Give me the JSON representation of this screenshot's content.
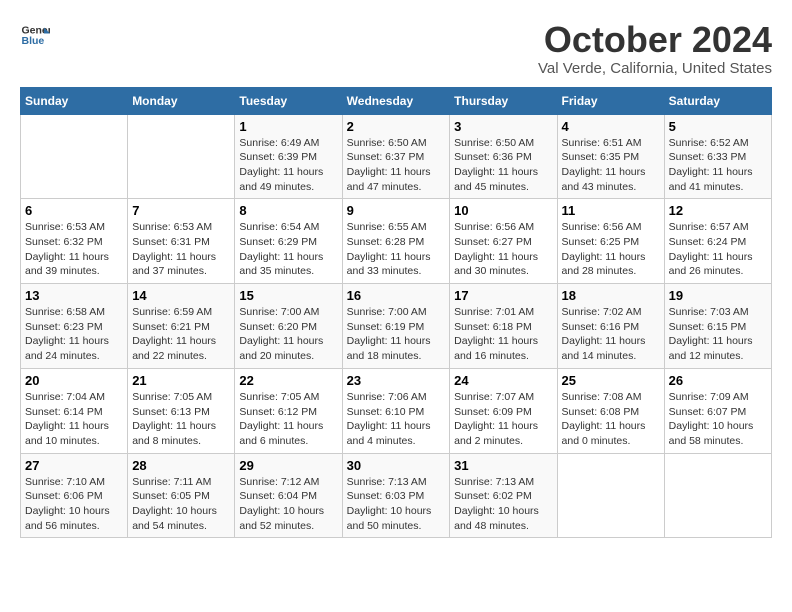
{
  "logo": {
    "line1": "General",
    "line2": "Blue"
  },
  "title": "October 2024",
  "location": "Val Verde, California, United States",
  "days_of_week": [
    "Sunday",
    "Monday",
    "Tuesday",
    "Wednesday",
    "Thursday",
    "Friday",
    "Saturday"
  ],
  "weeks": [
    [
      {
        "day": "",
        "info": ""
      },
      {
        "day": "",
        "info": ""
      },
      {
        "day": "1",
        "info": "Sunrise: 6:49 AM\nSunset: 6:39 PM\nDaylight: 11 hours and 49 minutes."
      },
      {
        "day": "2",
        "info": "Sunrise: 6:50 AM\nSunset: 6:37 PM\nDaylight: 11 hours and 47 minutes."
      },
      {
        "day": "3",
        "info": "Sunrise: 6:50 AM\nSunset: 6:36 PM\nDaylight: 11 hours and 45 minutes."
      },
      {
        "day": "4",
        "info": "Sunrise: 6:51 AM\nSunset: 6:35 PM\nDaylight: 11 hours and 43 minutes."
      },
      {
        "day": "5",
        "info": "Sunrise: 6:52 AM\nSunset: 6:33 PM\nDaylight: 11 hours and 41 minutes."
      }
    ],
    [
      {
        "day": "6",
        "info": "Sunrise: 6:53 AM\nSunset: 6:32 PM\nDaylight: 11 hours and 39 minutes."
      },
      {
        "day": "7",
        "info": "Sunrise: 6:53 AM\nSunset: 6:31 PM\nDaylight: 11 hours and 37 minutes."
      },
      {
        "day": "8",
        "info": "Sunrise: 6:54 AM\nSunset: 6:29 PM\nDaylight: 11 hours and 35 minutes."
      },
      {
        "day": "9",
        "info": "Sunrise: 6:55 AM\nSunset: 6:28 PM\nDaylight: 11 hours and 33 minutes."
      },
      {
        "day": "10",
        "info": "Sunrise: 6:56 AM\nSunset: 6:27 PM\nDaylight: 11 hours and 30 minutes."
      },
      {
        "day": "11",
        "info": "Sunrise: 6:56 AM\nSunset: 6:25 PM\nDaylight: 11 hours and 28 minutes."
      },
      {
        "day": "12",
        "info": "Sunrise: 6:57 AM\nSunset: 6:24 PM\nDaylight: 11 hours and 26 minutes."
      }
    ],
    [
      {
        "day": "13",
        "info": "Sunrise: 6:58 AM\nSunset: 6:23 PM\nDaylight: 11 hours and 24 minutes."
      },
      {
        "day": "14",
        "info": "Sunrise: 6:59 AM\nSunset: 6:21 PM\nDaylight: 11 hours and 22 minutes."
      },
      {
        "day": "15",
        "info": "Sunrise: 7:00 AM\nSunset: 6:20 PM\nDaylight: 11 hours and 20 minutes."
      },
      {
        "day": "16",
        "info": "Sunrise: 7:00 AM\nSunset: 6:19 PM\nDaylight: 11 hours and 18 minutes."
      },
      {
        "day": "17",
        "info": "Sunrise: 7:01 AM\nSunset: 6:18 PM\nDaylight: 11 hours and 16 minutes."
      },
      {
        "day": "18",
        "info": "Sunrise: 7:02 AM\nSunset: 6:16 PM\nDaylight: 11 hours and 14 minutes."
      },
      {
        "day": "19",
        "info": "Sunrise: 7:03 AM\nSunset: 6:15 PM\nDaylight: 11 hours and 12 minutes."
      }
    ],
    [
      {
        "day": "20",
        "info": "Sunrise: 7:04 AM\nSunset: 6:14 PM\nDaylight: 11 hours and 10 minutes."
      },
      {
        "day": "21",
        "info": "Sunrise: 7:05 AM\nSunset: 6:13 PM\nDaylight: 11 hours and 8 minutes."
      },
      {
        "day": "22",
        "info": "Sunrise: 7:05 AM\nSunset: 6:12 PM\nDaylight: 11 hours and 6 minutes."
      },
      {
        "day": "23",
        "info": "Sunrise: 7:06 AM\nSunset: 6:10 PM\nDaylight: 11 hours and 4 minutes."
      },
      {
        "day": "24",
        "info": "Sunrise: 7:07 AM\nSunset: 6:09 PM\nDaylight: 11 hours and 2 minutes."
      },
      {
        "day": "25",
        "info": "Sunrise: 7:08 AM\nSunset: 6:08 PM\nDaylight: 11 hours and 0 minutes."
      },
      {
        "day": "26",
        "info": "Sunrise: 7:09 AM\nSunset: 6:07 PM\nDaylight: 10 hours and 58 minutes."
      }
    ],
    [
      {
        "day": "27",
        "info": "Sunrise: 7:10 AM\nSunset: 6:06 PM\nDaylight: 10 hours and 56 minutes."
      },
      {
        "day": "28",
        "info": "Sunrise: 7:11 AM\nSunset: 6:05 PM\nDaylight: 10 hours and 54 minutes."
      },
      {
        "day": "29",
        "info": "Sunrise: 7:12 AM\nSunset: 6:04 PM\nDaylight: 10 hours and 52 minutes."
      },
      {
        "day": "30",
        "info": "Sunrise: 7:13 AM\nSunset: 6:03 PM\nDaylight: 10 hours and 50 minutes."
      },
      {
        "day": "31",
        "info": "Sunrise: 7:13 AM\nSunset: 6:02 PM\nDaylight: 10 hours and 48 minutes."
      },
      {
        "day": "",
        "info": ""
      },
      {
        "day": "",
        "info": ""
      }
    ]
  ]
}
